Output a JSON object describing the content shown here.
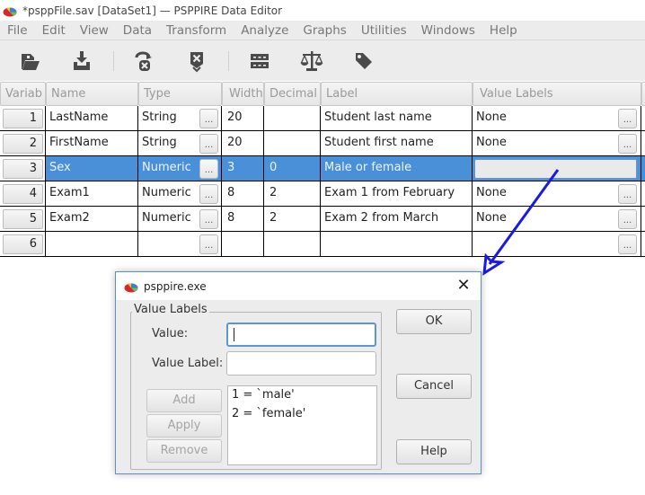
{
  "window": {
    "title": "*psppFile.sav [DataSet1] — PSPPIRE Data Editor",
    "app_icon": "pspp-pie-icon"
  },
  "menubar": {
    "items": [
      "File",
      "Edit",
      "View",
      "Data",
      "Transform",
      "Analyze",
      "Graphs",
      "Utilities",
      "Windows",
      "Help"
    ]
  },
  "toolbar": {
    "buttons": [
      {
        "name": "open-file",
        "icon": "open-folder-icon"
      },
      {
        "name": "save-file",
        "icon": "download-tray-icon"
      },
      {
        "name": "goto-case",
        "icon": "goto-case-icon"
      },
      {
        "name": "goto-variable",
        "icon": "goto-variable-icon"
      },
      {
        "name": "split-file",
        "icon": "split-rows-icon"
      },
      {
        "name": "weight-cases",
        "icon": "scales-icon"
      },
      {
        "name": "value-labels",
        "icon": "tag-icon"
      }
    ]
  },
  "grid": {
    "columns": [
      "Variab",
      "Name",
      "Type",
      "Width",
      "Decimal",
      "Label",
      "Value Labels"
    ],
    "rows": [
      {
        "num": "1",
        "name": "LastName",
        "type": "String",
        "width": "20",
        "decimals": "",
        "label": "Student last name",
        "value_labels": "None"
      },
      {
        "num": "2",
        "name": "FirstName",
        "type": "String",
        "width": "20",
        "decimals": "",
        "label": "Student first name",
        "value_labels": "None"
      },
      {
        "num": "3",
        "name": "Sex",
        "type": "Numeric",
        "width": "3",
        "decimals": "0",
        "label": "Male or female",
        "value_labels": ""
      },
      {
        "num": "4",
        "name": "Exam1",
        "type": "Numeric",
        "width": "8",
        "decimals": "2",
        "label": "Exam 1 from February",
        "value_labels": "None"
      },
      {
        "num": "5",
        "name": "Exam2",
        "type": "Numeric",
        "width": "8",
        "decimals": "2",
        "label": "Exam 2 from March",
        "value_labels": "None"
      },
      {
        "num": "6",
        "name": "",
        "type": "",
        "width": "",
        "decimals": "",
        "label": "",
        "value_labels": ""
      }
    ],
    "selected_row": 3,
    "dots_label": "..."
  },
  "dialog": {
    "title": "psppire.exe",
    "close_glyph": "✕",
    "frame_label": "Value Labels",
    "value_label": "Value:",
    "value_input": "",
    "value_label_label": "Value Label:",
    "value_label_input": "",
    "add": "Add",
    "apply": "Apply",
    "remove": "Remove",
    "list": [
      "1 = `male'",
      "2 = `female'"
    ],
    "ok": "OK",
    "cancel": "Cancel",
    "help": "Help"
  },
  "colors": {
    "selection": "#4a90d9",
    "annotation_arrow": "#1a1ae0"
  }
}
